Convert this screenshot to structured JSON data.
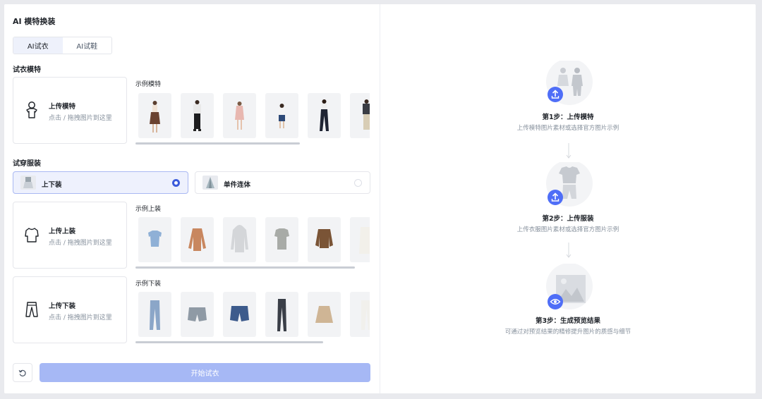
{
  "app": {
    "title": "AI 模特换装"
  },
  "tabs": [
    {
      "label": "AI试衣",
      "active": true
    },
    {
      "label": "AI试鞋",
      "active": false
    }
  ],
  "model_section": {
    "label": "试衣模特",
    "upload_title": "上传模特",
    "upload_sub": "点击 / 拖拽图片到这里",
    "examples_label": "示例模特",
    "examples": [
      "model-1",
      "model-2",
      "model-3",
      "model-4",
      "model-5",
      "model-6"
    ]
  },
  "garment_section": {
    "label": "试穿服装",
    "options": [
      {
        "label": "上下装",
        "selected": true
      },
      {
        "label": "单件连体",
        "selected": false
      }
    ],
    "top": {
      "upload_title": "上传上装",
      "upload_sub": "点击 / 拖拽图片到这里",
      "examples_label": "示例上装",
      "examples": [
        "blue-crop-top",
        "brown-sweater",
        "grey-hoodie",
        "grey-polo",
        "brown-puffer-jacket",
        "white-shirt"
      ]
    },
    "bottom": {
      "upload_title": "上传下装",
      "upload_sub": "点击 / 拖拽图片到这里",
      "examples_label": "示例下装",
      "examples": [
        "light-jeans",
        "denim-shorts",
        "blue-denim-shorts",
        "dark-jeans",
        "pleated-skirt",
        "white-pants"
      ]
    }
  },
  "actions": {
    "reset_icon": "refresh-icon",
    "start_label": "开始试衣"
  },
  "steps": [
    {
      "title": "第1步：上传模特",
      "desc": "上传模特图片素材或选择官方图片示例",
      "icon": "upload-icon"
    },
    {
      "title": "第2步：上传服装",
      "desc": "上传衣服图片素材或选择官方图片示例",
      "icon": "upload-icon"
    },
    {
      "title": "第3步：生成预览结果",
      "desc": "可通过对预览结果的精修提升图片的质感与细节",
      "icon": "eye-icon"
    }
  ],
  "colors": {
    "accent": "#3b5bdb",
    "button_disabled": "#a6b8f5",
    "step_badge": "#4f6ef7"
  }
}
